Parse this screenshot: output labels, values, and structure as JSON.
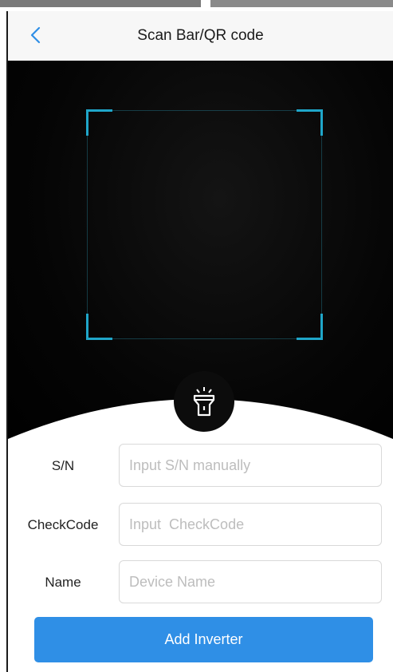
{
  "header": {
    "title": "Scan Bar/QR code",
    "back_icon": "chevron-left-icon"
  },
  "scanner": {
    "flashlight_icon": "flashlight-icon",
    "frame_color": "#1fa6c9"
  },
  "form": {
    "fields": [
      {
        "label": "S/N",
        "placeholder": "Input S/N manually",
        "value": ""
      },
      {
        "label": "CheckCode",
        "placeholder": "Input  CheckCode",
        "value": ""
      },
      {
        "label": "Name",
        "placeholder": "Device Name",
        "value": ""
      }
    ]
  },
  "actions": {
    "add_label": "Add Inverter",
    "button_color": "#2f8fe6"
  },
  "colors": {
    "accent": "#2f8fe6",
    "scan_frame": "#1fa6c9"
  }
}
